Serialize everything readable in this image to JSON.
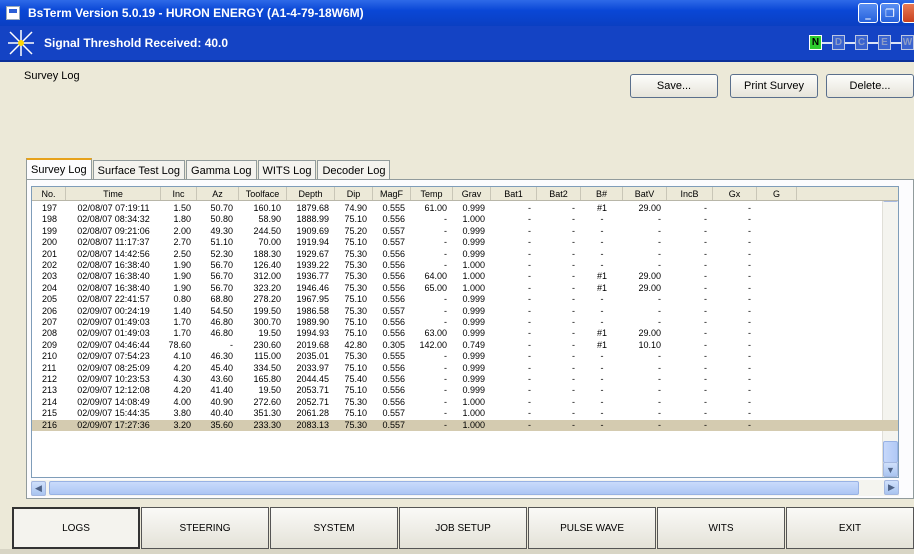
{
  "window": {
    "title": "BsTerm Version 5.0.19 - HURON ENERGY (A1-4-79-18W6M)",
    "controls": [
      "_",
      "❐",
      ""
    ]
  },
  "status": {
    "signal_text": "Signal Threshold Received: 40.0",
    "indicators": [
      {
        "label": "N",
        "active": true
      },
      {
        "label": "D",
        "active": false
      },
      {
        "label": "C",
        "active": false
      },
      {
        "label": "E",
        "active": false
      },
      {
        "label": "W",
        "active": false
      }
    ]
  },
  "page": {
    "title": "Survey Log",
    "buttons": {
      "save": "Save...",
      "print": "Print Survey",
      "delete": "Delete..."
    }
  },
  "tabs": [
    "Survey Log",
    "Surface Test Log",
    "Gamma Log",
    "WITS Log",
    "Decoder Log"
  ],
  "active_tab": 0,
  "table": {
    "columns": [
      "No.",
      "Time",
      "Inc",
      "Az",
      "Toolface",
      "Depth",
      "Dip",
      "MagF",
      "Temp",
      "Grav",
      "Bat1",
      "Bat2",
      "B#",
      "BatV",
      "IncB",
      "Gx",
      "G"
    ],
    "selected_row": 19,
    "rows": [
      [
        "197",
        "02/08/07 07:19:11",
        "1.50",
        "50.70",
        "160.10",
        "1879.68",
        "74.90",
        "0.555",
        "61.00",
        "0.999",
        "-",
        "-",
        "#1",
        "29.00",
        "-",
        "-",
        ""
      ],
      [
        "198",
        "02/08/07 08:34:32",
        "1.80",
        "50.80",
        "58.90",
        "1888.99",
        "75.10",
        "0.556",
        "-",
        "1.000",
        "-",
        "-",
        "-",
        "-",
        "-",
        "-",
        ""
      ],
      [
        "199",
        "02/08/07 09:21:06",
        "2.00",
        "49.30",
        "244.50",
        "1909.69",
        "75.20",
        "0.557",
        "-",
        "0.999",
        "-",
        "-",
        "-",
        "-",
        "-",
        "-",
        ""
      ],
      [
        "200",
        "02/08/07 11:17:37",
        "2.70",
        "51.10",
        "70.00",
        "1919.94",
        "75.10",
        "0.557",
        "-",
        "0.999",
        "-",
        "-",
        "-",
        "-",
        "-",
        "-",
        ""
      ],
      [
        "201",
        "02/08/07 14:42:56",
        "2.50",
        "52.30",
        "188.30",
        "1929.67",
        "75.30",
        "0.556",
        "-",
        "0.999",
        "-",
        "-",
        "-",
        "-",
        "-",
        "-",
        ""
      ],
      [
        "202",
        "02/08/07 16:38:40",
        "1.90",
        "56.70",
        "126.40",
        "1939.22",
        "75.30",
        "0.556",
        "-",
        "1.000",
        "-",
        "-",
        "-",
        "-",
        "-",
        "-",
        ""
      ],
      [
        "203",
        "02/08/07 16:38:40",
        "1.90",
        "56.70",
        "312.00",
        "1936.77",
        "75.30",
        "0.556",
        "64.00",
        "1.000",
        "-",
        "-",
        "#1",
        "29.00",
        "-",
        "-",
        ""
      ],
      [
        "204",
        "02/08/07 16:38:40",
        "1.90",
        "56.70",
        "323.20",
        "1946.46",
        "75.30",
        "0.556",
        "65.00",
        "1.000",
        "-",
        "-",
        "#1",
        "29.00",
        "-",
        "-",
        ""
      ],
      [
        "205",
        "02/08/07 22:41:57",
        "0.80",
        "68.80",
        "278.20",
        "1967.95",
        "75.10",
        "0.556",
        "-",
        "0.999",
        "-",
        "-",
        "-",
        "-",
        "-",
        "-",
        ""
      ],
      [
        "206",
        "02/09/07 00:24:19",
        "1.40",
        "54.50",
        "199.50",
        "1986.58",
        "75.30",
        "0.557",
        "-",
        "0.999",
        "-",
        "-",
        "-",
        "-",
        "-",
        "-",
        ""
      ],
      [
        "207",
        "02/09/07 01:49:03",
        "1.70",
        "46.80",
        "300.70",
        "1989.90",
        "75.10",
        "0.556",
        "-",
        "0.999",
        "-",
        "-",
        "-",
        "-",
        "-",
        "-",
        ""
      ],
      [
        "208",
        "02/09/07 01:49:03",
        "1.70",
        "46.80",
        "19.50",
        "1994.93",
        "75.10",
        "0.556",
        "63.00",
        "0.999",
        "-",
        "-",
        "#1",
        "29.00",
        "-",
        "-",
        ""
      ],
      [
        "209",
        "02/09/07 04:46:44",
        "78.60",
        "-",
        "230.60",
        "2019.68",
        "42.80",
        "0.305",
        "142.00",
        "0.749",
        "-",
        "-",
        "#1",
        "10.10",
        "-",
        "-",
        ""
      ],
      [
        "210",
        "02/09/07 07:54:23",
        "4.10",
        "46.30",
        "115.00",
        "2035.01",
        "75.30",
        "0.555",
        "-",
        "0.999",
        "-",
        "-",
        "-",
        "-",
        "-",
        "-",
        ""
      ],
      [
        "211",
        "02/09/07 08:25:09",
        "4.20",
        "45.40",
        "334.50",
        "2033.97",
        "75.10",
        "0.556",
        "-",
        "0.999",
        "-",
        "-",
        "-",
        "-",
        "-",
        "-",
        ""
      ],
      [
        "212",
        "02/09/07 10:23:53",
        "4.30",
        "43.60",
        "165.80",
        "2044.45",
        "75.40",
        "0.556",
        "-",
        "0.999",
        "-",
        "-",
        "-",
        "-",
        "-",
        "-",
        ""
      ],
      [
        "213",
        "02/09/07 12:12:08",
        "4.20",
        "41.40",
        "19.50",
        "2053.71",
        "75.10",
        "0.556",
        "-",
        "0.999",
        "-",
        "-",
        "-",
        "-",
        "-",
        "-",
        ""
      ],
      [
        "214",
        "02/09/07 14:08:49",
        "4.00",
        "40.90",
        "272.60",
        "2052.71",
        "75.30",
        "0.556",
        "-",
        "1.000",
        "-",
        "-",
        "-",
        "-",
        "-",
        "-",
        ""
      ],
      [
        "215",
        "02/09/07 15:44:35",
        "3.80",
        "40.40",
        "351.30",
        "2061.28",
        "75.10",
        "0.557",
        "-",
        "1.000",
        "-",
        "-",
        "-",
        "-",
        "-",
        "-",
        ""
      ],
      [
        "216",
        "02/09/07 17:27:36",
        "3.20",
        "35.60",
        "233.30",
        "2083.13",
        "75.30",
        "0.557",
        "-",
        "1.000",
        "-",
        "-",
        "-",
        "-",
        "-",
        "-",
        ""
      ]
    ]
  },
  "nav": [
    "LOGS",
    "STEERING",
    "SYSTEM",
    "JOB SETUP",
    "PULSE WAVE",
    "WITS",
    "EXIT"
  ],
  "active_nav": 0,
  "colors": {
    "titlebar": "#0a47d6",
    "statusbar": "#1443c4",
    "indicator_on": "#2ecc2e",
    "selected_row": "#d4cbb0",
    "tab_highlight": "#e7a21b"
  }
}
